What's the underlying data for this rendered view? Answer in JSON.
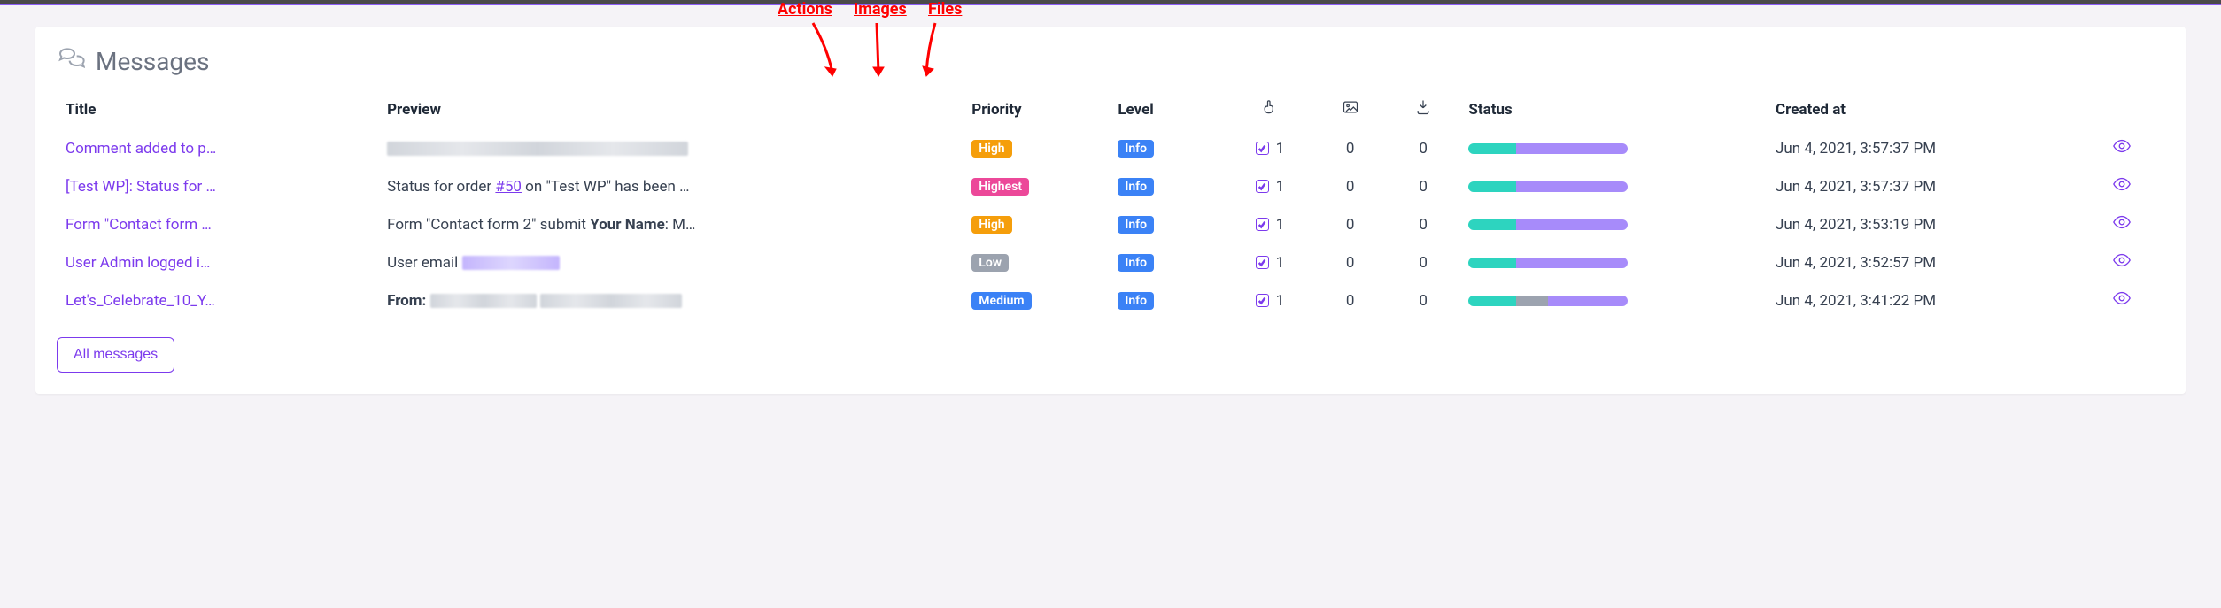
{
  "annotations": {
    "actions": "Actions",
    "images": "Images",
    "files": "Files"
  },
  "page": {
    "title": "Messages"
  },
  "columns": {
    "title": "Title",
    "preview": "Preview",
    "priority": "Priority",
    "level": "Level",
    "status": "Status",
    "created": "Created at"
  },
  "rows": [
    {
      "title": "Comment added to p…",
      "preview_type": "blur",
      "priority": "High",
      "level": "Info",
      "actions": 1,
      "images": 0,
      "files": 0,
      "status": [
        [
          "teal",
          30
        ],
        [
          "purple",
          70
        ]
      ],
      "created": "Jun 4, 2021, 3:57:37 PM"
    },
    {
      "title": "[Test WP]: Status for …",
      "preview_type": "order",
      "preview_pre": "Status for order ",
      "preview_link": "#50",
      "preview_post": " on \"Test WP\" has been …",
      "priority": "Highest",
      "level": "Info",
      "actions": 1,
      "images": 0,
      "files": 0,
      "status": [
        [
          "teal",
          30
        ],
        [
          "purple",
          70
        ]
      ],
      "created": "Jun 4, 2021, 3:57:37 PM"
    },
    {
      "title": "Form \"Contact form …",
      "preview_type": "form",
      "preview_pre": "Form \"Contact form 2\" submit ",
      "preview_bold": "Your Name",
      "preview_post": ": M…",
      "priority": "High",
      "level": "Info",
      "actions": 1,
      "images": 0,
      "files": 0,
      "status": [
        [
          "teal",
          30
        ],
        [
          "purple",
          70
        ]
      ],
      "created": "Jun 4, 2021, 3:53:19 PM"
    },
    {
      "title": "User Admin logged i…",
      "preview_type": "user",
      "preview_pre": "User email ",
      "priority": "Low",
      "level": "Info",
      "actions": 1,
      "images": 0,
      "files": 0,
      "status": [
        [
          "teal",
          30
        ],
        [
          "purple",
          70
        ]
      ],
      "created": "Jun 4, 2021, 3:52:57 PM"
    },
    {
      "title": "Let's_Celebrate_10_Y…",
      "preview_type": "from",
      "preview_bold": "From:",
      "priority": "Medium",
      "level": "Info",
      "actions": 1,
      "images": 0,
      "files": 0,
      "status": [
        [
          "teal",
          30
        ],
        [
          "gray",
          20
        ],
        [
          "purple",
          50
        ]
      ],
      "created": "Jun 4, 2021, 3:41:22 PM"
    }
  ],
  "footer": {
    "all_messages": "All messages"
  }
}
